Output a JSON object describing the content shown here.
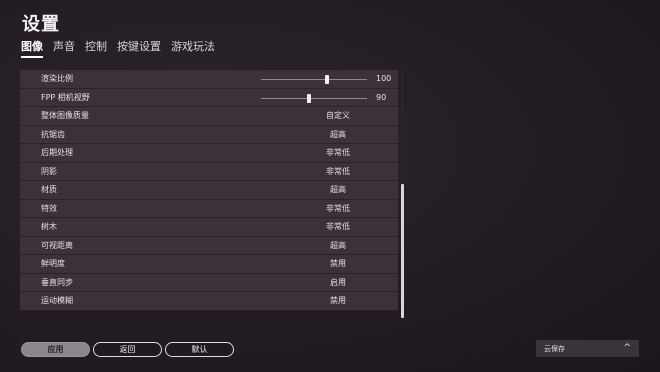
{
  "header": {
    "title": "设置"
  },
  "tabs": [
    {
      "label": "图像"
    },
    {
      "label": "声音"
    },
    {
      "label": "控制"
    },
    {
      "label": "按键设置"
    },
    {
      "label": "游戏玩法"
    }
  ],
  "settings": {
    "render_scale": {
      "label": "渲染比例",
      "value": "100",
      "level": 0.62
    },
    "fpp_fov": {
      "label": "FPP 相机视野",
      "value": "90",
      "level": 0.45
    },
    "rows": [
      {
        "label": "整体图像质量",
        "value": "自定义"
      },
      {
        "label": "抗锯齿",
        "value": "超高"
      },
      {
        "label": "后期处理",
        "value": "非常低"
      },
      {
        "label": "阴影",
        "value": "非常低"
      },
      {
        "label": "材质",
        "value": "超高"
      },
      {
        "label": "特效",
        "value": "非常低"
      },
      {
        "label": "树木",
        "value": "非常低"
      },
      {
        "label": "可视距离",
        "value": "超高"
      },
      {
        "label": "鲜明度",
        "value": "禁用"
      },
      {
        "label": "垂直同步",
        "value": "启用"
      },
      {
        "label": "运动模糊",
        "value": "禁用"
      }
    ]
  },
  "footer": {
    "apply_label": "应用",
    "back_label": "返回",
    "default_label": "默认",
    "cloud_save_label": "云保存",
    "cloud_chevron": "^"
  }
}
